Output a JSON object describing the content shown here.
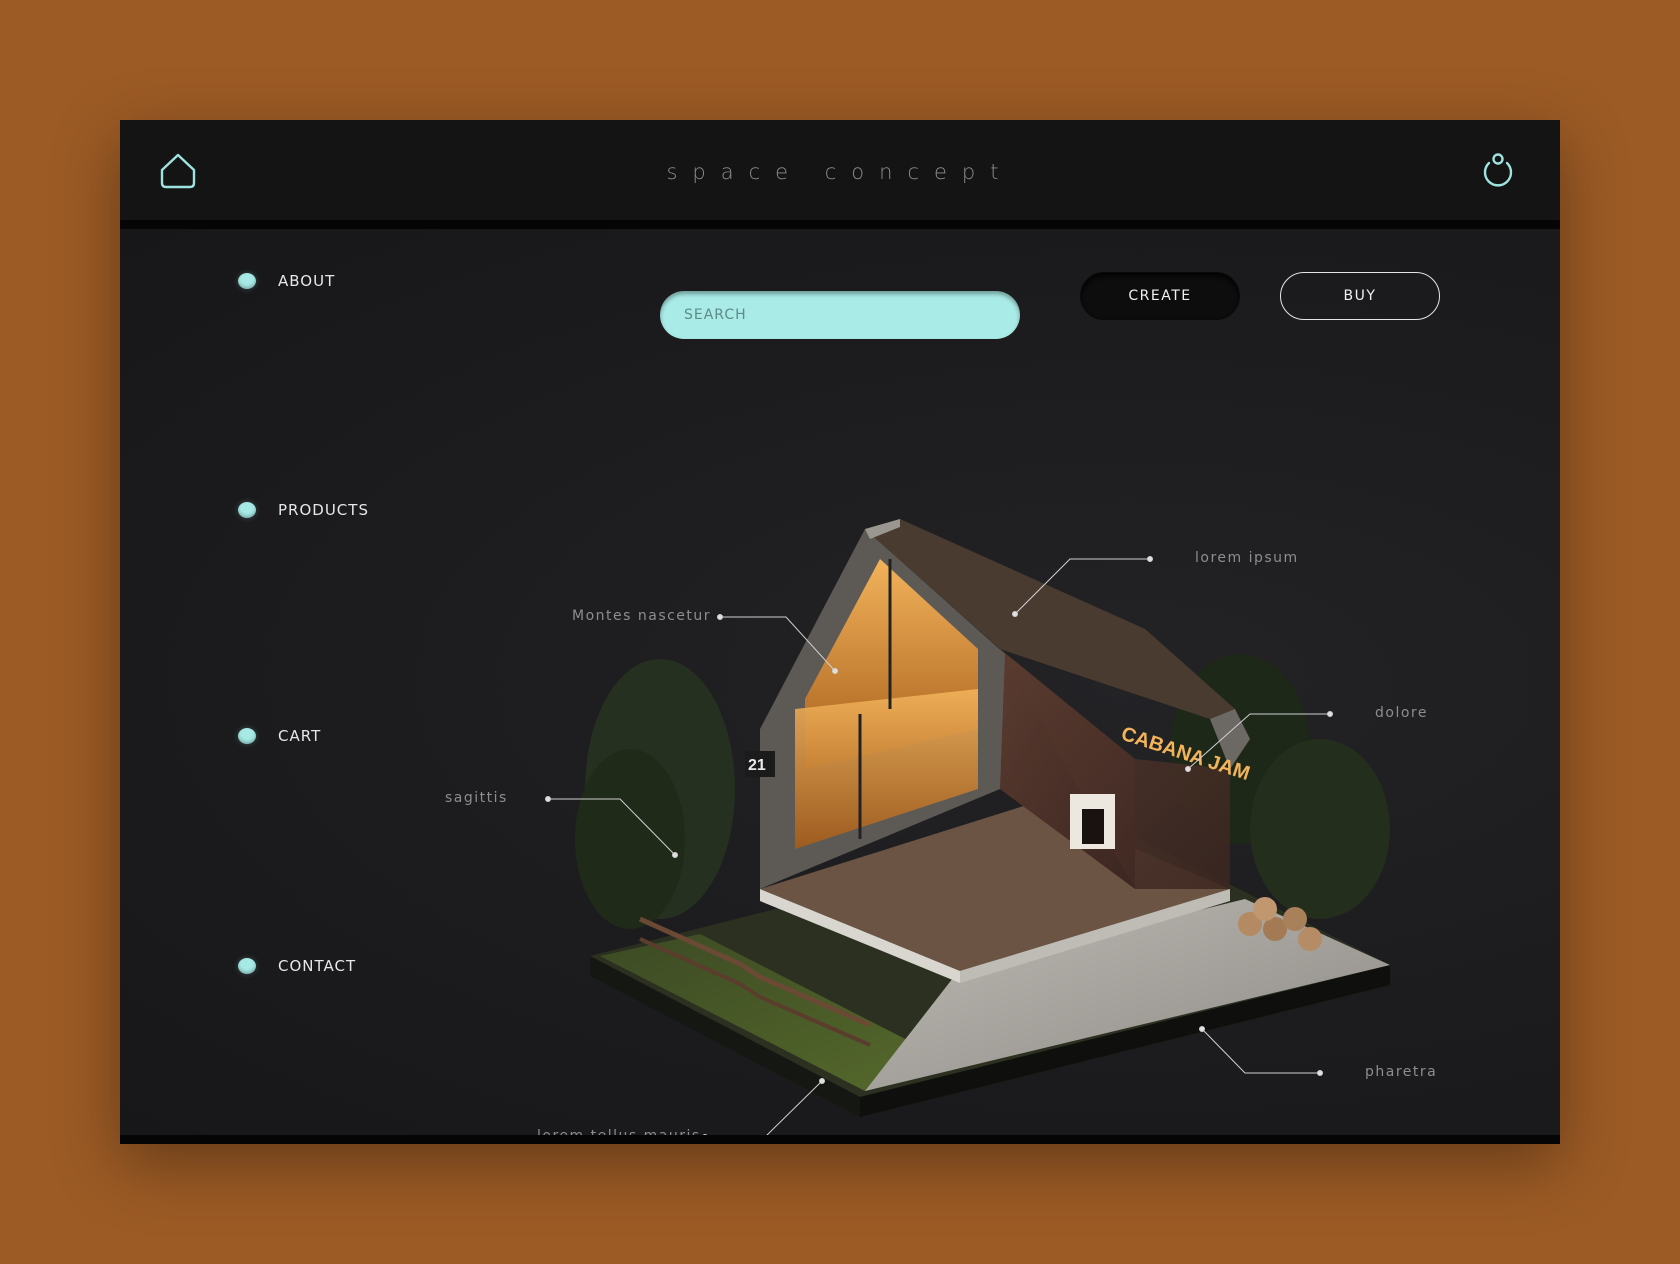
{
  "header": {
    "brand": "space concept",
    "home_icon": "home-outline-icon",
    "power_icon": "power-icon"
  },
  "nav": {
    "items": [
      {
        "label": "ABOUT"
      },
      {
        "label": "PRODUCTS"
      },
      {
        "label": "CART"
      },
      {
        "label": "CONTACT"
      }
    ]
  },
  "toolbar": {
    "search_placeholder": "SEARCH",
    "create_label": "CREATE",
    "buy_label": "BUY"
  },
  "scene": {
    "sign_text": "CABANA JAM",
    "house_number": "21",
    "callouts": [
      {
        "label": "lorem ipsum"
      },
      {
        "label": "Montes nascetur"
      },
      {
        "label": "dolore"
      },
      {
        "label": "sagittis"
      },
      {
        "label": "pharetra"
      },
      {
        "label": "lorem tellus mauris"
      }
    ]
  },
  "colors": {
    "background": "#9c5b25",
    "accent": "#a9ebe6",
    "panel": "#1a1a1c",
    "topbar": "#141415"
  }
}
